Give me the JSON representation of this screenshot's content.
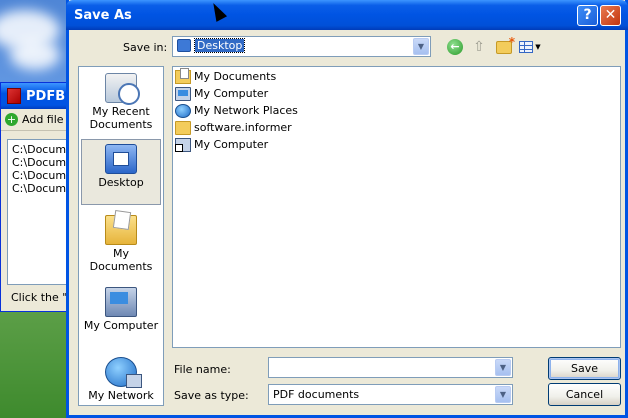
{
  "background_window": {
    "title": "PDFBin",
    "toolbar_add": "Add file",
    "list_items": [
      "C:\\Documents",
      "C:\\Documents",
      "C:\\Documents",
      "C:\\Documents"
    ],
    "status_text": "Click the \"b"
  },
  "dialog": {
    "title": "Save As",
    "help_label": "?",
    "close_label": "✕",
    "save_in_label": "Save in:",
    "save_in_value": "Desktop",
    "places": [
      {
        "label": "My Recent Documents",
        "icon": "recent-documents-icon"
      },
      {
        "label": "Desktop",
        "icon": "desktop-icon"
      },
      {
        "label": "My Documents",
        "icon": "my-documents-icon"
      },
      {
        "label": "My Computer",
        "icon": "my-computer-icon"
      },
      {
        "label": "My Network",
        "icon": "my-network-icon"
      }
    ],
    "files": [
      {
        "name": "My Documents",
        "icon": "my-documents-folder-icon"
      },
      {
        "name": "My Computer",
        "icon": "my-computer-icon"
      },
      {
        "name": "My Network Places",
        "icon": "network-places-icon"
      },
      {
        "name": "software.informer",
        "icon": "folder-icon"
      },
      {
        "name": "My Computer",
        "icon": "shortcut-icon"
      }
    ],
    "file_name_label": "File name:",
    "file_name_value": "",
    "save_as_type_label": "Save as type:",
    "save_as_type_value": "PDF documents",
    "save_button": "Save",
    "cancel_button": "Cancel"
  },
  "colors": {
    "titlebar_blue": "#0054e3",
    "dialog_face": "#ece9d8",
    "selection": "#316ac5"
  }
}
